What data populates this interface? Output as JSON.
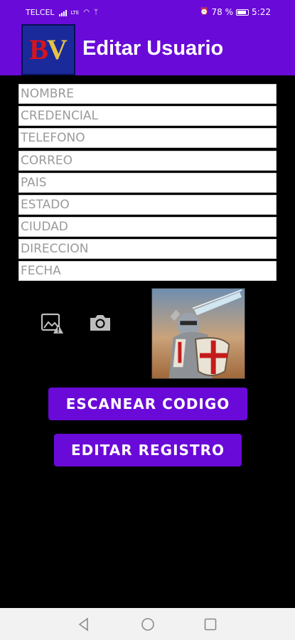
{
  "status_bar": {
    "carrier": "TELCEL",
    "network": "LTE",
    "battery": "78 %",
    "time": "5:22"
  },
  "app_bar": {
    "logo_b": "B",
    "logo_v": "V",
    "title": "Editar Usuario"
  },
  "form": {
    "fields": [
      {
        "placeholder": "NOMBRE"
      },
      {
        "placeholder": "CREDENCIAL"
      },
      {
        "placeholder": "TELEFONO"
      },
      {
        "placeholder": "CORREO"
      },
      {
        "placeholder": "PAIS"
      },
      {
        "placeholder": "ESTADO"
      },
      {
        "placeholder": "CIUDAD"
      },
      {
        "placeholder": "DIRECCION"
      },
      {
        "placeholder": "FECHA"
      }
    ]
  },
  "icons": {
    "image": "broken-image-icon",
    "camera": "camera-icon"
  },
  "buttons": {
    "scan_label": "ESCANEAR CODIGO",
    "edit_label": "EDITAR REGISTRO"
  },
  "colors": {
    "accent": "#6a0ad9",
    "background": "#000000"
  }
}
